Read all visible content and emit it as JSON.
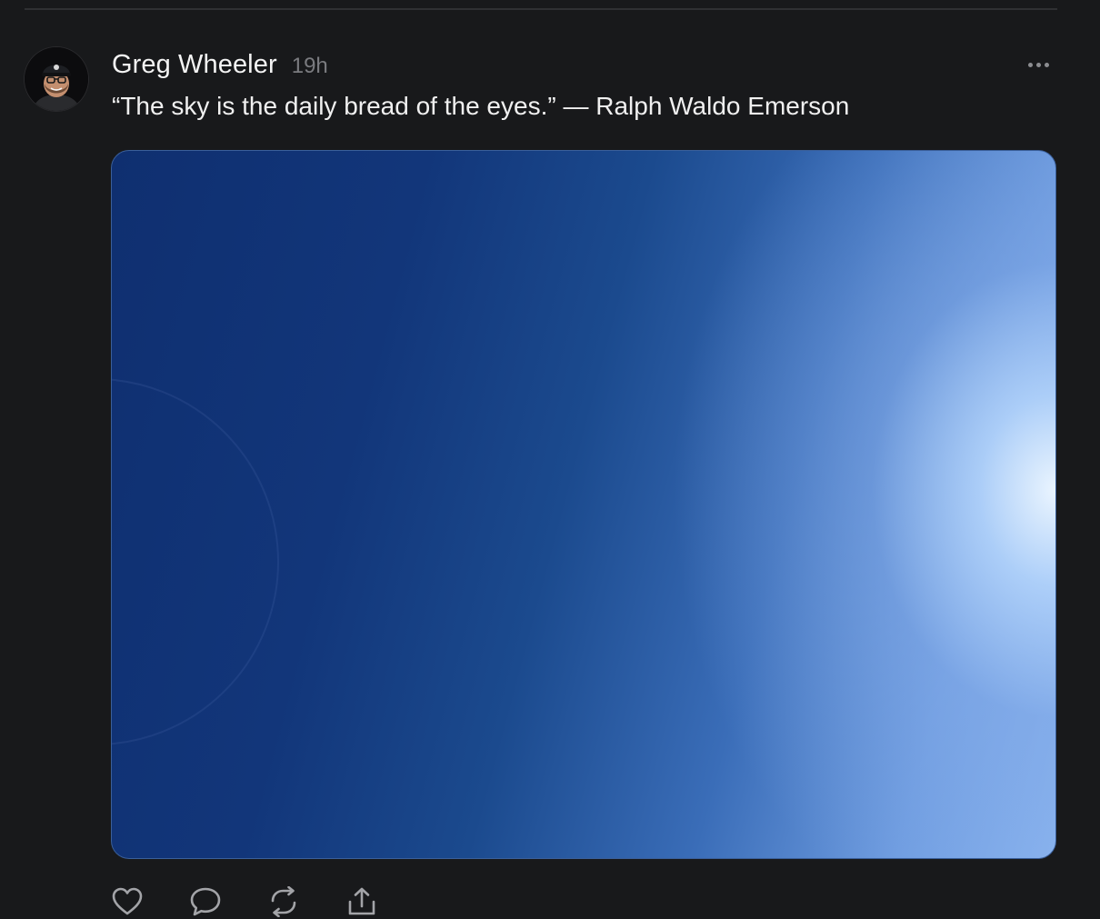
{
  "post": {
    "author": "Greg Wheeler",
    "time": "19h",
    "text": "“The sky is the daily bread of the eyes.” — Ralph Waldo Emerson",
    "more_icon": "more-horizontal-icon",
    "image_icon": "photo",
    "colors": {
      "background": "#18191b",
      "muted": "#7a7b7f",
      "sky_dark": "#0f2f70",
      "sky_light": "#8ab4ef"
    }
  },
  "actions": [
    {
      "icon": "heart-icon"
    },
    {
      "icon": "comment-icon"
    },
    {
      "icon": "repost-icon"
    },
    {
      "icon": "share-icon"
    }
  ]
}
